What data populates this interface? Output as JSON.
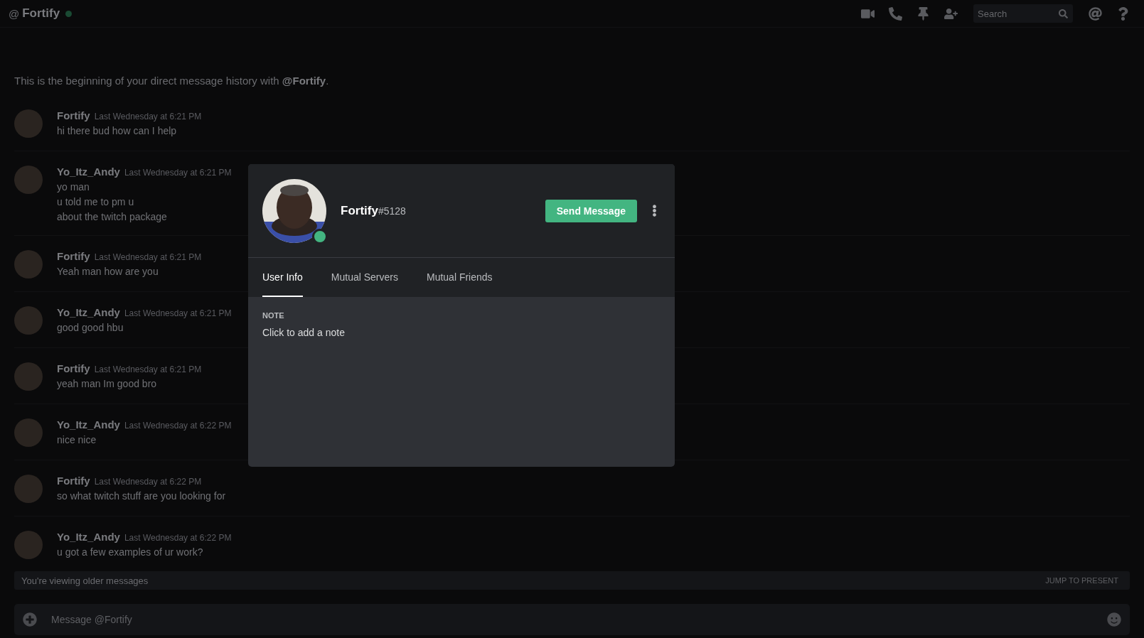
{
  "header": {
    "at": "@",
    "title": "Fortify",
    "online": true,
    "search": {
      "placeholder": "Search"
    }
  },
  "intro": "This is the beginning of your direct message history with **@Fortify**.",
  "messages": [
    {
      "author": "Fortify",
      "timestamp": "Last Wednesday at 6:21 PM",
      "lines": [
        "hi there bud how can I help"
      ]
    },
    {
      "author": "Yo_Itz_Andy",
      "timestamp": "Last Wednesday at 6:21 PM",
      "lines": [
        "yo man",
        "u told me to pm u",
        "about the twitch package"
      ]
    },
    {
      "author": "Fortify",
      "timestamp": "Last Wednesday at 6:21 PM",
      "lines": [
        "Yeah man how are you"
      ]
    },
    {
      "author": "Yo_Itz_Andy",
      "timestamp": "Last Wednesday at 6:21 PM",
      "lines": [
        "good good hbu"
      ]
    },
    {
      "author": "Fortify",
      "timestamp": "Last Wednesday at 6:21 PM",
      "lines": [
        "yeah man Im good bro"
      ]
    },
    {
      "author": "Yo_Itz_Andy",
      "timestamp": "Last Wednesday at 6:22 PM",
      "lines": [
        "nice nice"
      ]
    },
    {
      "author": "Fortify",
      "timestamp": "Last Wednesday at 6:22 PM",
      "lines": [
        "so what twitch stuff are you looking for"
      ]
    },
    {
      "author": "Yo_Itz_Andy",
      "timestamp": "Last Wednesday at 6:22 PM",
      "lines": [
        "u got a few examples of ur work?"
      ]
    }
  ],
  "older_bar": {
    "text": "You're viewing older messages",
    "action": "JUMP TO PRESENT"
  },
  "composer": {
    "placeholder": "Message @Fortify"
  },
  "profile": {
    "name": "Fortify",
    "discriminator": "#5128",
    "online": true,
    "button": "Send Message",
    "tabs": [
      {
        "label": "User Info",
        "selected": true
      },
      {
        "label": "Mutual Servers",
        "selected": false
      },
      {
        "label": "Mutual Friends",
        "selected": false
      }
    ],
    "note_label": "NOTE",
    "note_placeholder": "Click to add a note"
  }
}
